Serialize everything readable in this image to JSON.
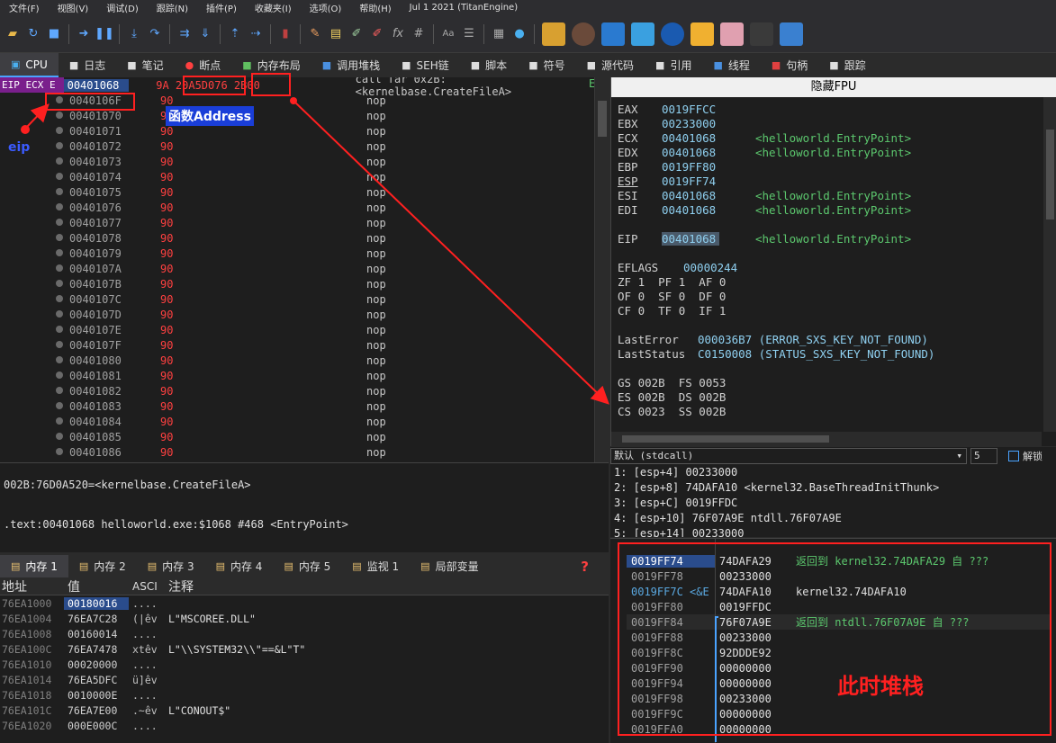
{
  "menu": [
    "文件(F)",
    "视图(V)",
    "调试(D)",
    "跟踪(N)",
    "插件(P)",
    "收藏夹(I)",
    "选项(O)",
    "帮助(H)",
    "Jul 1 2021 (TitanEngine)"
  ],
  "tabs": [
    {
      "label": "CPU",
      "icon": "cpu-icon"
    },
    {
      "label": "日志",
      "icon": "log-icon"
    },
    {
      "label": "笔记",
      "icon": "notes-icon"
    },
    {
      "label": "断点",
      "icon": "breakpoint-icon"
    },
    {
      "label": "内存布局",
      "icon": "memory-map-icon"
    },
    {
      "label": "调用堆栈",
      "icon": "call-stack-icon"
    },
    {
      "label": "SEH链",
      "icon": "seh-icon"
    },
    {
      "label": "脚本",
      "icon": "script-icon"
    },
    {
      "label": "符号",
      "icon": "symbols-icon"
    },
    {
      "label": "源代码",
      "icon": "source-icon"
    },
    {
      "label": "引用",
      "icon": "references-icon"
    },
    {
      "label": "线程",
      "icon": "threads-icon"
    },
    {
      "label": "句柄",
      "icon": "handles-icon"
    },
    {
      "label": "跟踪",
      "icon": "trace-icon"
    }
  ],
  "disasm": {
    "eip_label": "EIP ECX E",
    "rows": [
      {
        "addr": "00401068",
        "bytes": "9A 20A5D076 2B00",
        "instr": "call far 0x2B:<kernelbase.CreateFileA>"
      },
      {
        "addr": "0040106F",
        "bytes": "90",
        "instr": "nop"
      },
      {
        "addr": "00401070",
        "bytes": "90",
        "instr": "nop"
      },
      {
        "addr": "00401071",
        "bytes": "90",
        "instr": "nop"
      },
      {
        "addr": "00401072",
        "bytes": "90",
        "instr": "nop"
      },
      {
        "addr": "00401073",
        "bytes": "90",
        "instr": "nop"
      },
      {
        "addr": "00401074",
        "bytes": "90",
        "instr": "nop"
      },
      {
        "addr": "00401075",
        "bytes": "90",
        "instr": "nop"
      },
      {
        "addr": "00401076",
        "bytes": "90",
        "instr": "nop"
      },
      {
        "addr": "00401077",
        "bytes": "90",
        "instr": "nop"
      },
      {
        "addr": "00401078",
        "bytes": "90",
        "instr": "nop"
      },
      {
        "addr": "00401079",
        "bytes": "90",
        "instr": "nop"
      },
      {
        "addr": "0040107A",
        "bytes": "90",
        "instr": "nop"
      },
      {
        "addr": "0040107B",
        "bytes": "90",
        "instr": "nop"
      },
      {
        "addr": "0040107C",
        "bytes": "90",
        "instr": "nop"
      },
      {
        "addr": "0040107D",
        "bytes": "90",
        "instr": "nop"
      },
      {
        "addr": "0040107E",
        "bytes": "90",
        "instr": "nop"
      },
      {
        "addr": "0040107F",
        "bytes": "90",
        "instr": "nop"
      },
      {
        "addr": "00401080",
        "bytes": "90",
        "instr": "nop"
      },
      {
        "addr": "00401081",
        "bytes": "90",
        "instr": "nop"
      },
      {
        "addr": "00401082",
        "bytes": "90",
        "instr": "nop"
      },
      {
        "addr": "00401083",
        "bytes": "90",
        "instr": "nop"
      },
      {
        "addr": "00401084",
        "bytes": "90",
        "instr": "nop"
      },
      {
        "addr": "00401085",
        "bytes": "90",
        "instr": "nop"
      },
      {
        "addr": "00401086",
        "bytes": "90",
        "instr": "nop"
      }
    ],
    "first_row_tail": "E"
  },
  "info": {
    "line1": "002B:76D0A520=<kernelbase.CreateFileA>",
    "line2": ".text:00401068 helloworld.exe:$1068 #468 <EntryPoint>"
  },
  "annotations": {
    "eip": "eip",
    "func_address": "函数Address",
    "stack_now": "此时堆栈"
  },
  "registers": {
    "title": "隐藏FPU",
    "gp": [
      {
        "name": "EAX",
        "value": "0019FFCC",
        "comment": ""
      },
      {
        "name": "EBX",
        "value": "00233000",
        "comment": ""
      },
      {
        "name": "ECX",
        "value": "00401068",
        "comment": "<helloworld.EntryPoint>"
      },
      {
        "name": "EDX",
        "value": "00401068",
        "comment": "<helloworld.EntryPoint>"
      },
      {
        "name": "EBP",
        "value": "0019FF80",
        "comment": ""
      },
      {
        "name": "ESP",
        "value": "0019FF74",
        "comment": ""
      },
      {
        "name": "ESI",
        "value": "00401068",
        "comment": "<helloworld.EntryPoint>"
      },
      {
        "name": "EDI",
        "value": "00401068",
        "comment": "<helloworld.EntryPoint>"
      }
    ],
    "eip": {
      "name": "EIP",
      "value": "00401068",
      "comment": "<helloworld.EntryPoint>"
    },
    "eflags": {
      "name": "EFLAGS",
      "value": "00000244"
    },
    "flags": [
      "ZF 1  PF 1  AF 0",
      "OF 0  SF 0  DF 0",
      "CF 0  TF 0  IF 1"
    ],
    "lasterror": {
      "name": "LastError",
      "value": "000036B7 (ERROR_SXS_KEY_NOT_FOUND)"
    },
    "laststatus": {
      "name": "LastStatus",
      "value": "C0150008 (STATUS_SXS_KEY_NOT_FOUND)"
    },
    "segs": [
      "GS 002B  FS 0053",
      "ES 002B  DS 002B",
      "CS 0023  SS 002B"
    ]
  },
  "callconv": {
    "selected": "默认 (stdcall)",
    "count": "5",
    "unlock_label": "解锁",
    "args": [
      "1: [esp+4] 00233000",
      "2: [esp+8] 74DAFA10 <kernel32.BaseThreadInitThunk>",
      "3: [esp+C] 0019FFDC",
      "4: [esp+10] 76F07A9E ntdll.76F07A9E",
      "5: [esp+14] 00233000"
    ]
  },
  "stack": [
    {
      "addr": "0019FF74",
      "val": "74DAFA29",
      "cmt": "返回到 kernel32.74DAFA29 自 ???"
    },
    {
      "addr": "0019FF78",
      "val": "00233000",
      "cmt": ""
    },
    {
      "addr": "0019FF7C <&E",
      "val": "74DAFA10",
      "cmt": "kernel32.74DAFA10"
    },
    {
      "addr": "0019FF80",
      "val": "0019FFDC",
      "cmt": ""
    },
    {
      "addr": "0019FF84",
      "val": "76F07A9E",
      "cmt": "返回到 ntdll.76F07A9E 自 ???"
    },
    {
      "addr": "0019FF88",
      "val": "00233000",
      "cmt": ""
    },
    {
      "addr": "0019FF8C",
      "val": "92DDDE92",
      "cmt": ""
    },
    {
      "addr": "0019FF90",
      "val": "00000000",
      "cmt": ""
    },
    {
      "addr": "0019FF94",
      "val": "00000000",
      "cmt": ""
    },
    {
      "addr": "0019FF98",
      "val": "00233000",
      "cmt": ""
    },
    {
      "addr": "0019FF9C",
      "val": "00000000",
      "cmt": ""
    },
    {
      "addr": "0019FFA0",
      "val": "00000000",
      "cmt": ""
    }
  ],
  "memtabs": [
    {
      "label": "内存 1",
      "active": true
    },
    {
      "label": "内存 2",
      "active": false
    },
    {
      "label": "内存 3",
      "active": false
    },
    {
      "label": "内存 4",
      "active": false
    },
    {
      "label": "内存 5",
      "active": false
    },
    {
      "label": "监视 1",
      "active": false
    },
    {
      "label": "局部变量",
      "active": false
    }
  ],
  "memhdr": {
    "addr": "地址",
    "val": "值",
    "asc": "ASCI",
    "cmt": "注释"
  },
  "memdump": [
    {
      "addr": "76EA1000",
      "val": "00180016",
      "asc": "....",
      "cmt": ""
    },
    {
      "addr": "76EA1004",
      "val": "76EA7C28",
      "asc": "(|êv",
      "cmt": "L\"MSCOREE.DLL\""
    },
    {
      "addr": "76EA1008",
      "val": "00160014",
      "asc": "....",
      "cmt": ""
    },
    {
      "addr": "76EA100C",
      "val": "76EA7478",
      "asc": "xtêv",
      "cmt": "L\"\\\\SYSTEM32\\\\\"==&L\"T\""
    },
    {
      "addr": "76EA1010",
      "val": "00020000",
      "asc": "....",
      "cmt": ""
    },
    {
      "addr": "76EA1014",
      "val": "76EA5DFC",
      "asc": "ü]êv",
      "cmt": ""
    },
    {
      "addr": "76EA1018",
      "val": "0010000E",
      "asc": "....",
      "cmt": ""
    },
    {
      "addr": "76EA101C",
      "val": "76EA7E00",
      "asc": ".~êv",
      "cmt": "L\"CONOUT$\""
    },
    {
      "addr": "76EA1020",
      "val": "000E000C",
      "asc": "....",
      "cmt": ""
    }
  ]
}
